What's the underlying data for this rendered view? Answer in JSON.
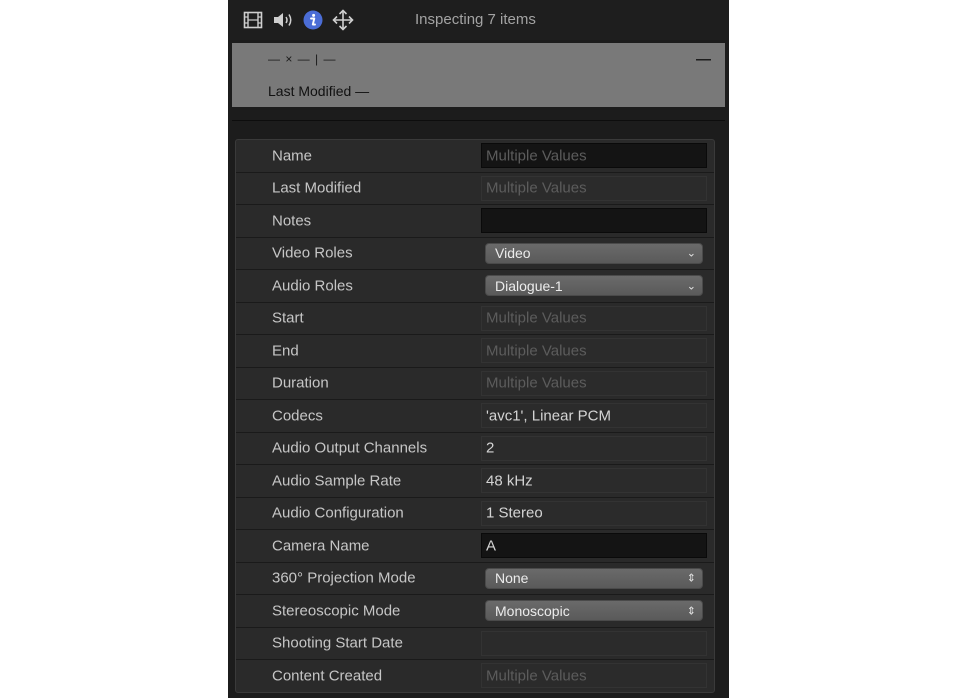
{
  "toolbar": {
    "title": "Inspecting 7 items",
    "icons": [
      "film-icon",
      "audio-icon",
      "info-icon",
      "transform-icon"
    ]
  },
  "header": {
    "line1": "— × — | —",
    "collapse_symbol": "—",
    "line2": "Last Modified —"
  },
  "properties": {
    "name": {
      "label": "Name",
      "value": "Multiple Values"
    },
    "last_modified": {
      "label": "Last Modified",
      "value": "Multiple Values"
    },
    "notes": {
      "label": "Notes",
      "value": ""
    },
    "video_roles": {
      "label": "Video Roles",
      "value": "Video"
    },
    "audio_roles": {
      "label": "Audio Roles",
      "value": "Dialogue-1"
    },
    "start": {
      "label": "Start",
      "value": "Multiple Values"
    },
    "end": {
      "label": "End",
      "value": "Multiple Values"
    },
    "duration": {
      "label": "Duration",
      "value": "Multiple Values"
    },
    "codecs": {
      "label": "Codecs",
      "value": "'avc1', Linear PCM"
    },
    "audio_output_channels": {
      "label": "Audio Output Channels",
      "value": "2"
    },
    "audio_sample_rate": {
      "label": "Audio Sample Rate",
      "value": "48 kHz"
    },
    "audio_configuration": {
      "label": "Audio Configuration",
      "value": "1 Stereo"
    },
    "camera_name": {
      "label": "Camera Name",
      "value": "A"
    },
    "projection_mode": {
      "label": "360° Projection Mode",
      "value": "None"
    },
    "stereoscopic_mode": {
      "label": "Stereoscopic Mode",
      "value": "Monoscopic"
    },
    "shooting_start_date": {
      "label": "Shooting Start Date",
      "value": ""
    },
    "content_created": {
      "label": "Content Created",
      "value": "Multiple Values"
    }
  },
  "colors": {
    "panel_bg": "#1c1c1c",
    "header_bg": "#797979",
    "info_accent": "#4b6dd6",
    "placeholder_text": "#5c5c5c"
  }
}
